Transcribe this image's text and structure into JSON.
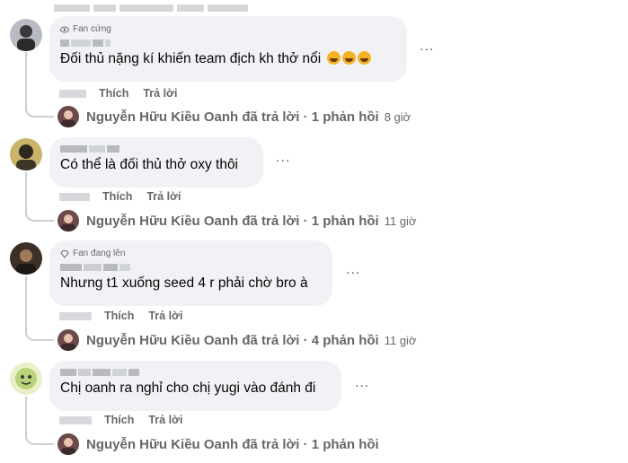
{
  "comments": [
    {
      "badge": "Fan cứng",
      "badge_icon": "eye-icon",
      "text": "Đối thủ nặng kí khiến team địch kh thở nổi",
      "emojis": [
        "laughing-emoji",
        "laughing-emoji",
        "laughing-emoji"
      ],
      "like_label": "Thích",
      "reply_label": "Trả lời",
      "replies_summary": "Nguyễn Hữu Kiều Oanh đã trả lời · 1 phản hồi",
      "replies_time": "8 giờ"
    },
    {
      "badge": "",
      "text": "Có thể là đối thủ thở oxy thôi",
      "like_label": "Thích",
      "reply_label": "Trả lời",
      "replies_summary": "Nguyễn Hữu Kiều Oanh đã trả lời · 1 phản hồi",
      "replies_time": "11 giờ"
    },
    {
      "badge": "Fan đang lên",
      "badge_icon": "diamond-icon",
      "text": "Nhưng t1 xuống seed 4 r phải chờ bro à",
      "like_label": "Thích",
      "reply_label": "Trả lời",
      "replies_summary": "Nguyễn Hữu Kiều Oanh đã trả lời · 4 phản hồi",
      "replies_time": "11 giờ"
    },
    {
      "badge": "",
      "text": "Chị oanh ra nghỉ cho chị yugi vào đánh đi",
      "like_label": "Thích",
      "reply_label": "Trả lời",
      "replies_summary": "Nguyễn Hữu Kiều Oanh đã trả lời · 1 phản hồi",
      "replies_time": ""
    }
  ],
  "more_label": "...",
  "colors": {
    "bubble": "#f0f2f5",
    "secondary_text": "#65676b",
    "thread_line": "#ccd0d5"
  }
}
